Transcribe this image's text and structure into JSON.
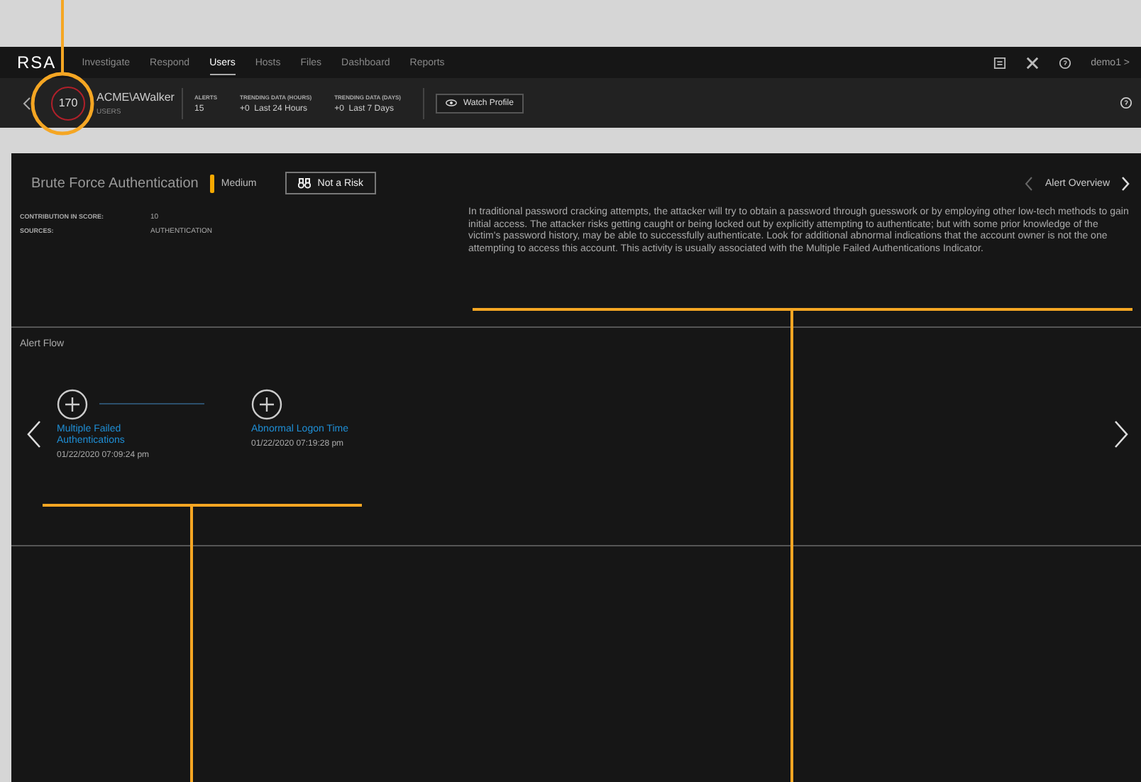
{
  "nav": {
    "logo": "RSA",
    "items": [
      {
        "label": "Investigate",
        "selected": false
      },
      {
        "label": "Respond",
        "selected": false
      },
      {
        "label": "Users",
        "selected": true
      },
      {
        "label": "Hosts",
        "selected": false
      },
      {
        "label": "Files",
        "selected": false
      },
      {
        "label": "Dashboard",
        "selected": false
      },
      {
        "label": "Reports",
        "selected": false
      }
    ],
    "user": "demo1 >"
  },
  "entity": {
    "score": "170",
    "name": "ACME\\AWalker",
    "type": "USERS",
    "stats": [
      {
        "label": "ALERTS",
        "value": "15"
      },
      {
        "label": "TRENDING DATA (HOURS)",
        "value": "+0  Last 24 Hours"
      },
      {
        "label": "TRENDING DATA (DAYS)",
        "value": "+0  Last 7 Days"
      }
    ],
    "watch_button": "Watch Profile"
  },
  "indicator": {
    "title": "Brute Force Authentication",
    "severity": {
      "label": "Medium",
      "color": "#f5a800"
    },
    "risk_button": "Not a Risk",
    "fields": [
      {
        "label": "CONTRIBUTION IN SCORE:",
        "value": "10"
      },
      {
        "label": "SOURCES:",
        "value": "AUTHENTICATION"
      }
    ],
    "nav_label": "Alert Overview",
    "description": "In traditional password cracking attempts, the attacker will try to obtain a password through guesswork or by employing other low-tech methods to gain initial access. The attacker risks getting caught or being locked out by explicitly attempting to authenticate; but with some prior knowledge of the victim's password history, may be able to successfully authenticate. Look for additional abnormal indications that the account owner is not the one attempting to access this account. This activity is usually associated with the Multiple Failed Authentications Indicator."
  },
  "alert_flow": {
    "title": "Alert Flow",
    "nodes": [
      {
        "name": "Multiple Failed Authentications",
        "time": "01/22/2020 07:09:24 pm"
      },
      {
        "name": "Abnormal Logon Time",
        "time": "01/22/2020 07:19:28 pm"
      }
    ]
  }
}
